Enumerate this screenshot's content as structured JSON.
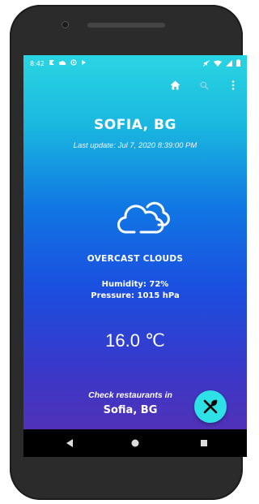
{
  "statusbar": {
    "time": "8:42",
    "left_icons": [
      "notification-icon",
      "cloud-icon",
      "at-icon",
      "play-icon"
    ],
    "right_icons": [
      "mute-icon",
      "wifi-icon",
      "signal-icon",
      "battery-icon"
    ]
  },
  "toolbar": {
    "icons": [
      "home-icon",
      "search-icon",
      "more-vert-icon"
    ]
  },
  "weather": {
    "city": "SOFIA, BG",
    "last_update": "Last update: Jul 7, 2020 8:39:00 PM",
    "condition_icon": "cloud-icon",
    "condition": "OVERCAST CLOUDS",
    "humidity": "Humidity: 72%",
    "pressure": "Pressure: 1015 hPa",
    "temperature": "16.0 ℃"
  },
  "restaurants": {
    "label": "Check restaurants in",
    "city": "Sofia, BG",
    "button_icon": "restaurant-icon"
  },
  "colors": {
    "gradient_top": "#2ad5e2",
    "gradient_bottom": "#5a2fb1",
    "fab": "#2ee1e6",
    "text": "#ffffff"
  },
  "navbar": {
    "icons": [
      "back-icon",
      "home-circle-icon",
      "recents-icon"
    ]
  }
}
